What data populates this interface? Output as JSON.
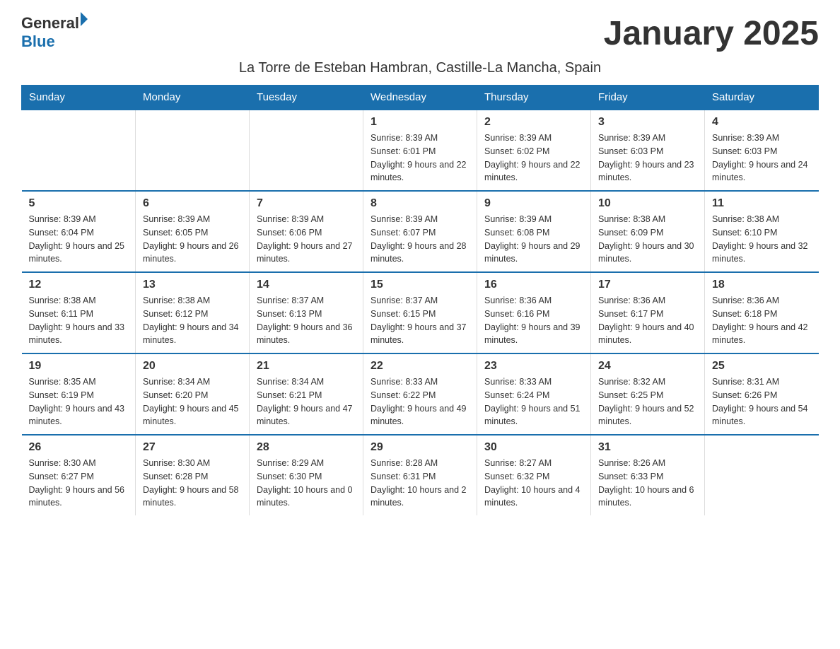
{
  "logo": {
    "text_general": "General",
    "text_blue": "Blue"
  },
  "page_title": "January 2025",
  "subtitle": "La Torre de Esteban Hambran, Castille-La Mancha, Spain",
  "calendar": {
    "headers": [
      "Sunday",
      "Monday",
      "Tuesday",
      "Wednesday",
      "Thursday",
      "Friday",
      "Saturday"
    ],
    "weeks": [
      [
        {
          "day": "",
          "info": ""
        },
        {
          "day": "",
          "info": ""
        },
        {
          "day": "",
          "info": ""
        },
        {
          "day": "1",
          "info": "Sunrise: 8:39 AM\nSunset: 6:01 PM\nDaylight: 9 hours and 22 minutes."
        },
        {
          "day": "2",
          "info": "Sunrise: 8:39 AM\nSunset: 6:02 PM\nDaylight: 9 hours and 22 minutes."
        },
        {
          "day": "3",
          "info": "Sunrise: 8:39 AM\nSunset: 6:03 PM\nDaylight: 9 hours and 23 minutes."
        },
        {
          "day": "4",
          "info": "Sunrise: 8:39 AM\nSunset: 6:03 PM\nDaylight: 9 hours and 24 minutes."
        }
      ],
      [
        {
          "day": "5",
          "info": "Sunrise: 8:39 AM\nSunset: 6:04 PM\nDaylight: 9 hours and 25 minutes."
        },
        {
          "day": "6",
          "info": "Sunrise: 8:39 AM\nSunset: 6:05 PM\nDaylight: 9 hours and 26 minutes."
        },
        {
          "day": "7",
          "info": "Sunrise: 8:39 AM\nSunset: 6:06 PM\nDaylight: 9 hours and 27 minutes."
        },
        {
          "day": "8",
          "info": "Sunrise: 8:39 AM\nSunset: 6:07 PM\nDaylight: 9 hours and 28 minutes."
        },
        {
          "day": "9",
          "info": "Sunrise: 8:39 AM\nSunset: 6:08 PM\nDaylight: 9 hours and 29 minutes."
        },
        {
          "day": "10",
          "info": "Sunrise: 8:38 AM\nSunset: 6:09 PM\nDaylight: 9 hours and 30 minutes."
        },
        {
          "day": "11",
          "info": "Sunrise: 8:38 AM\nSunset: 6:10 PM\nDaylight: 9 hours and 32 minutes."
        }
      ],
      [
        {
          "day": "12",
          "info": "Sunrise: 8:38 AM\nSunset: 6:11 PM\nDaylight: 9 hours and 33 minutes."
        },
        {
          "day": "13",
          "info": "Sunrise: 8:38 AM\nSunset: 6:12 PM\nDaylight: 9 hours and 34 minutes."
        },
        {
          "day": "14",
          "info": "Sunrise: 8:37 AM\nSunset: 6:13 PM\nDaylight: 9 hours and 36 minutes."
        },
        {
          "day": "15",
          "info": "Sunrise: 8:37 AM\nSunset: 6:15 PM\nDaylight: 9 hours and 37 minutes."
        },
        {
          "day": "16",
          "info": "Sunrise: 8:36 AM\nSunset: 6:16 PM\nDaylight: 9 hours and 39 minutes."
        },
        {
          "day": "17",
          "info": "Sunrise: 8:36 AM\nSunset: 6:17 PM\nDaylight: 9 hours and 40 minutes."
        },
        {
          "day": "18",
          "info": "Sunrise: 8:36 AM\nSunset: 6:18 PM\nDaylight: 9 hours and 42 minutes."
        }
      ],
      [
        {
          "day": "19",
          "info": "Sunrise: 8:35 AM\nSunset: 6:19 PM\nDaylight: 9 hours and 43 minutes."
        },
        {
          "day": "20",
          "info": "Sunrise: 8:34 AM\nSunset: 6:20 PM\nDaylight: 9 hours and 45 minutes."
        },
        {
          "day": "21",
          "info": "Sunrise: 8:34 AM\nSunset: 6:21 PM\nDaylight: 9 hours and 47 minutes."
        },
        {
          "day": "22",
          "info": "Sunrise: 8:33 AM\nSunset: 6:22 PM\nDaylight: 9 hours and 49 minutes."
        },
        {
          "day": "23",
          "info": "Sunrise: 8:33 AM\nSunset: 6:24 PM\nDaylight: 9 hours and 51 minutes."
        },
        {
          "day": "24",
          "info": "Sunrise: 8:32 AM\nSunset: 6:25 PM\nDaylight: 9 hours and 52 minutes."
        },
        {
          "day": "25",
          "info": "Sunrise: 8:31 AM\nSunset: 6:26 PM\nDaylight: 9 hours and 54 minutes."
        }
      ],
      [
        {
          "day": "26",
          "info": "Sunrise: 8:30 AM\nSunset: 6:27 PM\nDaylight: 9 hours and 56 minutes."
        },
        {
          "day": "27",
          "info": "Sunrise: 8:30 AM\nSunset: 6:28 PM\nDaylight: 9 hours and 58 minutes."
        },
        {
          "day": "28",
          "info": "Sunrise: 8:29 AM\nSunset: 6:30 PM\nDaylight: 10 hours and 0 minutes."
        },
        {
          "day": "29",
          "info": "Sunrise: 8:28 AM\nSunset: 6:31 PM\nDaylight: 10 hours and 2 minutes."
        },
        {
          "day": "30",
          "info": "Sunrise: 8:27 AM\nSunset: 6:32 PM\nDaylight: 10 hours and 4 minutes."
        },
        {
          "day": "31",
          "info": "Sunrise: 8:26 AM\nSunset: 6:33 PM\nDaylight: 10 hours and 6 minutes."
        },
        {
          "day": "",
          "info": ""
        }
      ]
    ]
  }
}
